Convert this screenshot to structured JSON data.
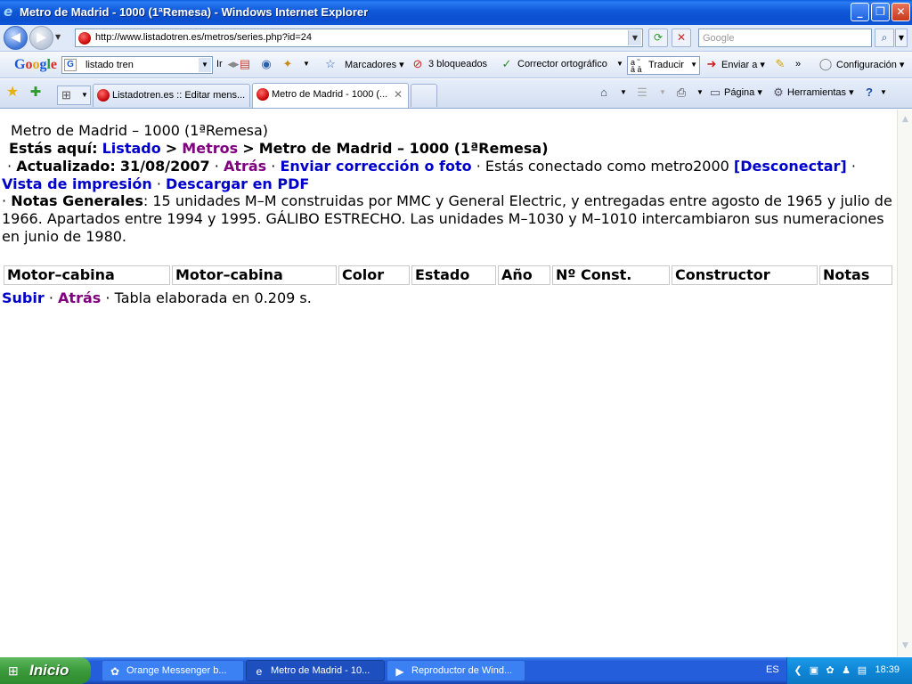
{
  "window": {
    "title": "Metro de Madrid - 1000 (1ªRemesa) - Windows Internet Explorer",
    "buttons": {
      "minimize": "_",
      "restore": "❐",
      "close": "✕"
    }
  },
  "addressbar": {
    "url": "http://www.listadotren.es/metros/series.php?id=24",
    "search_placeholder": "Google"
  },
  "google_toolbar": {
    "logo": [
      "G",
      "o",
      "o",
      "g",
      "l",
      "e"
    ],
    "search_value": "listado tren",
    "ir_label": "Ir",
    "marcadores": "Marcadores",
    "bloqueados": "3 bloqueados",
    "corrector": "Corrector ortográfico",
    "traducir": "Traducir",
    "enviar": "Enviar a",
    "configuracion": "Configuración"
  },
  "tabs": [
    {
      "label": "Listadotren.es :: Editar mens...",
      "active": false
    },
    {
      "label": "Metro de Madrid - 1000 (...",
      "active": true
    }
  ],
  "command_bar": {
    "pagina": "Página",
    "herramientas": "Herramientas"
  },
  "page": {
    "heading": "Metro de Madrid – 1000 (1ªRemesa)",
    "breadcrumb": {
      "prefix": "Estás aquí:",
      "listado": "Listado",
      "sep1": ">",
      "metros": "Metros",
      "sep2": ">",
      "current": "Metro de Madrid – 1000 (1ªRemesa)"
    },
    "updated": {
      "bullet": "·",
      "label": "Actualizado:",
      "date": "31/08/2007",
      "atras": "Atrás",
      "enviar": "Enviar corrección o foto",
      "connected": "Estás conectado como metro2000",
      "desconectar": "[Desconectar]"
    },
    "print": {
      "vista": "Vista de impresión",
      "pdf": "Descargar en PDF"
    },
    "notes": {
      "label": "Notas Generales",
      "text": ": 15 unidades M–M construidas por MMC y General Electric, y entregadas entre agosto de 1965 y julio de 1966. Apartados entre 1994 y 1995. GÁLIBO ESTRECHO. Las unidades M–1030 y M–1010 intercambiaron sus numeraciones en junio de 1980."
    },
    "table_headers": [
      "Motor–cabina",
      "Motor–cabina",
      "Color",
      "Estado",
      "Año",
      "Nº Const.",
      "Constructor",
      "Notas"
    ],
    "footer": {
      "subir": "Subir",
      "atras": "Atrás",
      "elapsed": "Tabla elaborada en 0.209 s."
    }
  },
  "taskbar": {
    "start": "Inicio",
    "tasks": [
      {
        "label": "Orange Messenger b...",
        "active": false
      },
      {
        "label": "Metro de Madrid - 10...",
        "active": true
      },
      {
        "label": "Reproductor de Wind...",
        "active": false
      }
    ],
    "lang": "ES",
    "time": "18:39"
  }
}
